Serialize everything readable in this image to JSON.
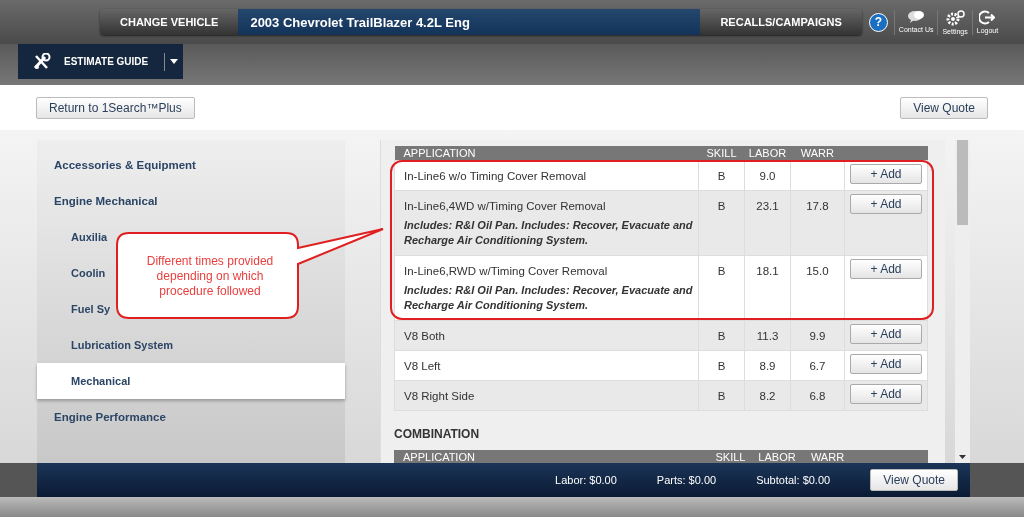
{
  "header": {
    "change_vehicle": "CHANGE VEHICLE",
    "vehicle": "2003 Chevrolet TrailBlazer 4.2L Eng",
    "recalls": "RECALLS/CAMPAIGNS",
    "help": "?",
    "links": [
      {
        "kind": "chat",
        "label": "Contact Us"
      },
      {
        "kind": "gear",
        "label": "Settings"
      },
      {
        "kind": "logout",
        "label": "Logout"
      }
    ]
  },
  "nav": {
    "tab": "ESTIMATE GUIDE"
  },
  "toolbar": {
    "return_button": "Return to 1Search™Plus",
    "view_quote": "View Quote"
  },
  "sidebar": {
    "items": [
      {
        "label": "Accessories & Equipment",
        "selected": false
      },
      {
        "label": "Engine Mechanical",
        "selected": false,
        "children": [
          {
            "label": "Auxilia",
            "selected": false
          },
          {
            "label": "Coolin",
            "selected": false
          },
          {
            "label": "Fuel Sy",
            "selected": false
          },
          {
            "label": "Lubrication System",
            "selected": false
          },
          {
            "label": "Mechanical",
            "selected": true
          }
        ]
      },
      {
        "label": "Engine Performance",
        "selected": false
      }
    ]
  },
  "tables": [
    {
      "columns": [
        "APPLICATION",
        "SKILL",
        "LABOR",
        "WARR"
      ],
      "rows": [
        {
          "application": "In-Line6 w/o Timing Cover Removal",
          "skill": "B",
          "labor": "9.0",
          "add": "+ Add"
        },
        {
          "application": "In-Line6,4WD w/Timing Cover Removal",
          "note": "Includes: R&I Oil Pan. Includes: Recover, Evacuate and Recharge Air Conditioning System.",
          "skill": "B",
          "labor": "23.1",
          "warr": "17.8",
          "add": "+ Add"
        },
        {
          "application": "In-Line6,RWD w/Timing Cover Removal",
          "note": "Includes: R&I Oil Pan. Includes: Recover, Evacuate and Recharge Air Conditioning System.",
          "skill": "B",
          "labor": "18.1",
          "warr": "15.0",
          "add": "+ Add"
        },
        {
          "application": "V8 Both",
          "skill": "B",
          "labor": "11.3",
          "warr": "9.9",
          "add": "+ Add"
        },
        {
          "application": "V8 Left",
          "skill": "B",
          "labor": "8.9",
          "warr": "6.7",
          "add": "+ Add"
        },
        {
          "application": "V8 Right Side",
          "skill": "B",
          "labor": "8.2",
          "warr": "6.8",
          "add": "+ Add"
        }
      ]
    },
    {
      "title": "COMBINATION",
      "columns": [
        "APPLICATION",
        "SKILL",
        "LABOR",
        "WARR"
      ]
    }
  ],
  "footer": {
    "totals": [
      "Labor: $0.00",
      "Parts: $0.00",
      "Subtotal: $0.00"
    ],
    "view_quote": "View Quote"
  },
  "callout": {
    "text": "Different times provided depending on which procedure followed"
  }
}
